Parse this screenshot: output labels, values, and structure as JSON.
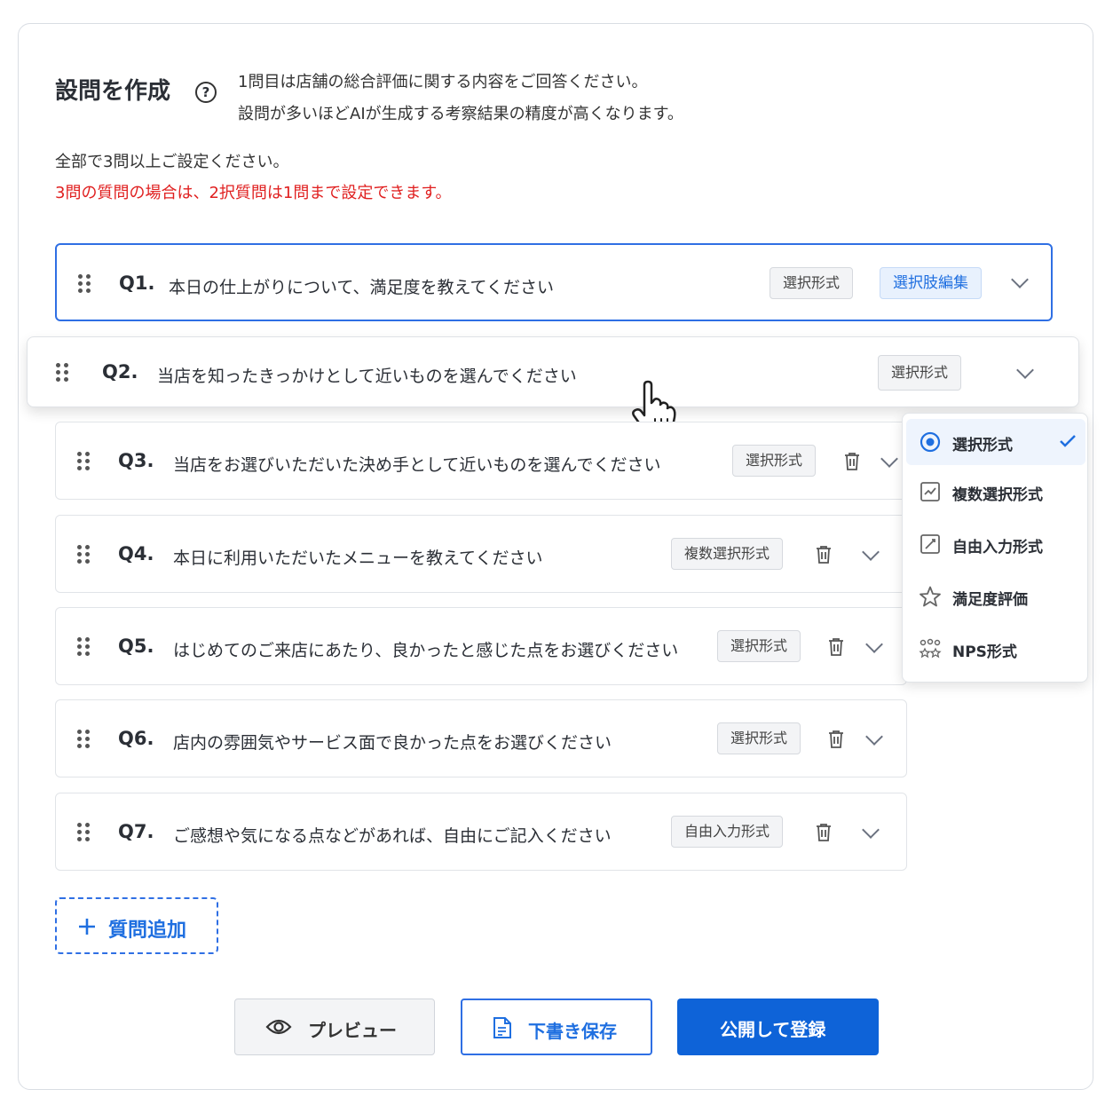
{
  "header": {
    "title": "設問を作成",
    "help_icon": "?",
    "description_line1": "1問目は店舗の総合評価に関する内容をご回答ください。",
    "description_line2": "設問が多いほどAIが生成する考察結果の精度が高くなります。"
  },
  "notes": {
    "info": "全部で3問以上ご設定ください。",
    "warning": "3問の質問の場合は、2択質問は1問まで設定できます。",
    "warning_color": "#e02020"
  },
  "questions": [
    {
      "num": "Q1.",
      "text": "本日の仕上がりについて、満足度を教えてください",
      "type": "選択形式",
      "extra": "選択肢編集"
    },
    {
      "num": "Q2.",
      "text": "当店を知ったきっかけとして近いものを選んでください",
      "type": "選択形式"
    },
    {
      "num": "Q3.",
      "text": "当店をお選びいただいた決め手として近いものを選んでください",
      "type": "選択形式"
    },
    {
      "num": "Q4.",
      "text": "本日に利用いただいたメニューを教えてください",
      "type": "複数選択形式"
    },
    {
      "num": "Q5.",
      "text": "はじめてのご来店にあたり、良かったと感じた点をお選びください",
      "type": "選択形式"
    },
    {
      "num": "Q6.",
      "text": "店内の雰囲気やサービス面で良かった点をお選びください",
      "type": "選択形式"
    },
    {
      "num": "Q7.",
      "text": "ご感想や気になる点などがあれば、自由にご記入ください",
      "type": "自由入力形式"
    }
  ],
  "dropdown": {
    "items": [
      {
        "label": "選択形式",
        "icon": "radio-icon",
        "selected": true
      },
      {
        "label": "複数選択形式",
        "icon": "multi-select-icon"
      },
      {
        "label": "自由入力形式",
        "icon": "free-input-icon"
      },
      {
        "label": "満足度評価",
        "icon": "star-icon"
      },
      {
        "label": "NPS形式",
        "icon": "nps-icon"
      }
    ]
  },
  "actions": {
    "add_question": "質問追加",
    "preview": "プレビュー",
    "save_draft": "下書き保存",
    "publish": "公開して登録"
  },
  "colors": {
    "accent": "#2f6fe4",
    "primary_button": "#0e63d8"
  }
}
